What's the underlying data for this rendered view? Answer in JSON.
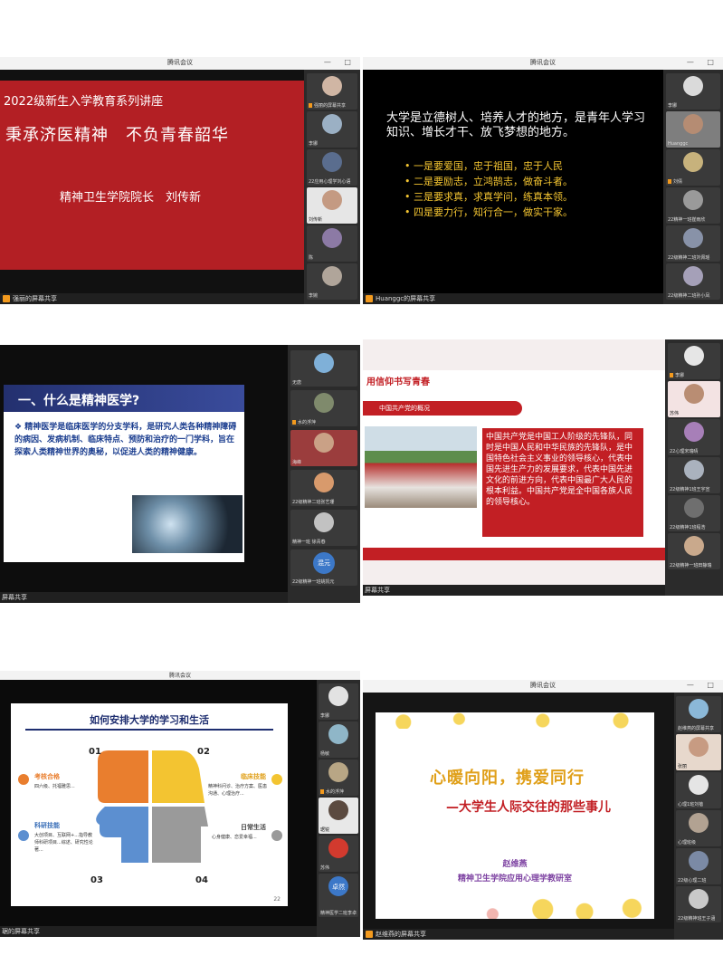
{
  "panels": [
    {
      "title": "腾讯会议",
      "share_label": "强丽的屏幕共享",
      "slide": {
        "series": "2022级新生入学教育系列讲座",
        "headline": "秉承济医精神　不负青春韶华",
        "speaker": "精神卫生学院院长　刘传新"
      },
      "participants": [
        "强丽的屏幕共享",
        "李娜",
        "22应用心理学刘心语",
        "刘传新",
        "陈",
        "李婉"
      ]
    },
    {
      "title": "腾讯会议",
      "share_label": "Huanggc的屏幕共享",
      "slide": {
        "intro": "大学是立德树人、培养人才的地方，是青年人学习知识、增长才干、放飞梦想的地方。",
        "points": [
          "一是要爱国，忠于祖国，忠于人民",
          "二是要励志，立鸿鹄志，做奋斗者。",
          "三是要求真，求真学问，练真本领。",
          "四是要力行，知行合一，做实干家。"
        ]
      },
      "participants": [
        "李娜",
        "Huanggc",
        "刘倩",
        "22精神一班崔雨欣",
        "22级精神二班刘佩瑶",
        "22级精神二班孙小凤"
      ]
    },
    {
      "share_label": "屏幕共享",
      "slide": {
        "heading": "一、什么是精神医学?",
        "body": "精神医学是临床医学的分支学科，是研究人类各种精神障碍的病因、发病机制、临床特点、预防和治疗的一门学科，旨在探索人类精神世界的奥秘，以促进人类的精神健康。"
      },
      "participants": [
        "无唐",
        "水的浮萍",
        "海峰",
        "22级精神二班张艺珊",
        "精神一班 徐青春",
        "混元",
        "22级精神一班姚凯元"
      ]
    },
    {
      "share_label": "屏幕共享",
      "slide": {
        "banner": "用信仰书写青春",
        "section": "中国共产党的概况",
        "body": "中国共产党是中国工人阶级的先锋队，同时是中国人民和中华民族的先锋队，是中国特色社会主义事业的领导核心，代表中国先进生产力的发展要求，代表中国先进文化的前进方向，代表中国最广大人民的根本利益。中国共产党是全中国各族人民的领导核心。"
      },
      "participants": [
        "李娜",
        "苏伟",
        "22心理宋瑞晴",
        "22级精神1班王宇宣",
        "22级精神1班程浩",
        "22级精神一班田静瑞"
      ]
    },
    {
      "title": "腾讯会议",
      "share_label": "琚的屏幕共享",
      "slide": {
        "heading": "如何安排大学的学习和生活",
        "quads": [
          {
            "num": "01",
            "title": "考核合格",
            "detail": "四六级、托福雅思..."
          },
          {
            "num": "02",
            "title": "临床技能",
            "detail": "精神科问诊、治疗方案、医患沟通、心理治疗..."
          },
          {
            "num": "03",
            "title": "科研技能",
            "detail": "大创项目、互联网+...指导教师科研项目...综述、研究性论著..."
          },
          {
            "num": "04",
            "title": "日常生活",
            "detail": "心身健康、恋爱幸福..."
          }
        ],
        "page": "22"
      },
      "participants": [
        "李娜",
        "杨敏",
        "水的浮萍",
        "琚锐",
        "苏伟",
        "卓然",
        "精神医学二班李卓然"
      ]
    },
    {
      "title": "腾讯会议",
      "share_label": "赵维燕的屏幕共享",
      "slide": {
        "title1": "心暖向阳，携爱同行",
        "title2": "—大学生人际交往的那些事儿",
        "presenter": "赵维燕",
        "dept": "精神卫生学院应用心理学教研室"
      },
      "participants": [
        "赵维燕的屏幕共享",
        "张丽",
        "心理1班刘蓓",
        "心理班级",
        "22级心理二班",
        "22级精神班王子涵"
      ]
    }
  ],
  "colors": {
    "red": "#b31f24",
    "orange": "#e97e2e",
    "yellow": "#f3c431",
    "blue": "#5c8fd0",
    "gray": "#9a9a9a",
    "purple": "#7b3fa0",
    "slide_yellow": "#f6d65c"
  }
}
